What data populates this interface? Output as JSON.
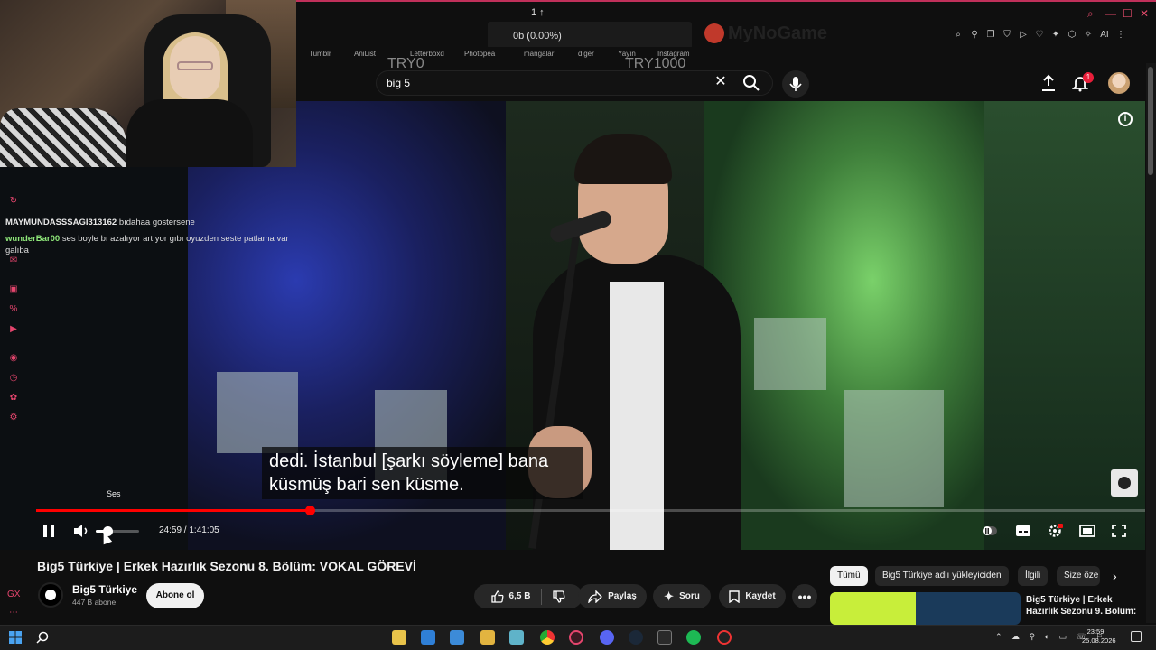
{
  "browser": {
    "download_count": "1 ↑",
    "download_value": "0b (0.00%)",
    "logo_text": "MyNoGame",
    "bookmarks": [
      "Tumblr",
      "AniList",
      "Letterboxd",
      "Photopea",
      "mangalar",
      "diger",
      "Yayın",
      "Instagram"
    ],
    "try_left": "TRY0",
    "try_right": "TRY1000",
    "ext_ai_label": "AI"
  },
  "chat": {
    "messages": [
      {
        "user": "MAYMUNDASSSAGI313162",
        "text": "bıdahaa gostersene"
      },
      {
        "user": "wunderBar00",
        "text": "ses boyle bı azalıyor artıyor gıbı oyuzden seste patlama var galıba"
      }
    ]
  },
  "search": {
    "query": "big 5"
  },
  "notifications": {
    "count": "1"
  },
  "video": {
    "subtitle_line1": "dedi. İstanbul [şarkı söyleme] bana",
    "subtitle_line2": "küsmüş bari sen küsme.",
    "volume_tooltip": "Ses",
    "current_time": "24:59",
    "duration": "1:41:05",
    "progress": 0.247,
    "volume": 0.2
  },
  "details": {
    "title": "Big5 Türkiye | Erkek Hazırlık Sezonu 8. Bölüm: VOKAL GÖREVİ",
    "channel": "Big5 Türkiye",
    "subscribers": "447 B abone",
    "subscribe_label": "Abone ol",
    "likes": "6,5 B",
    "share_label": "Paylaş",
    "ask_label": "Soru",
    "save_label": "Kaydet"
  },
  "chips": [
    "Tümü",
    "Big5 Türkiye adlı yükleyiciden",
    "İlgili",
    "Size öze"
  ],
  "recommendation": {
    "title": "Big5 Türkiye | Erkek Hazırlık Sezonu 9. Bölüm:"
  },
  "taskbar": {
    "time": "23:59",
    "date": "25.08.2026"
  },
  "colors": {
    "accent": "#ff0000",
    "chat_user_green": "#8fe87a",
    "side_icon": "#e5456d"
  }
}
